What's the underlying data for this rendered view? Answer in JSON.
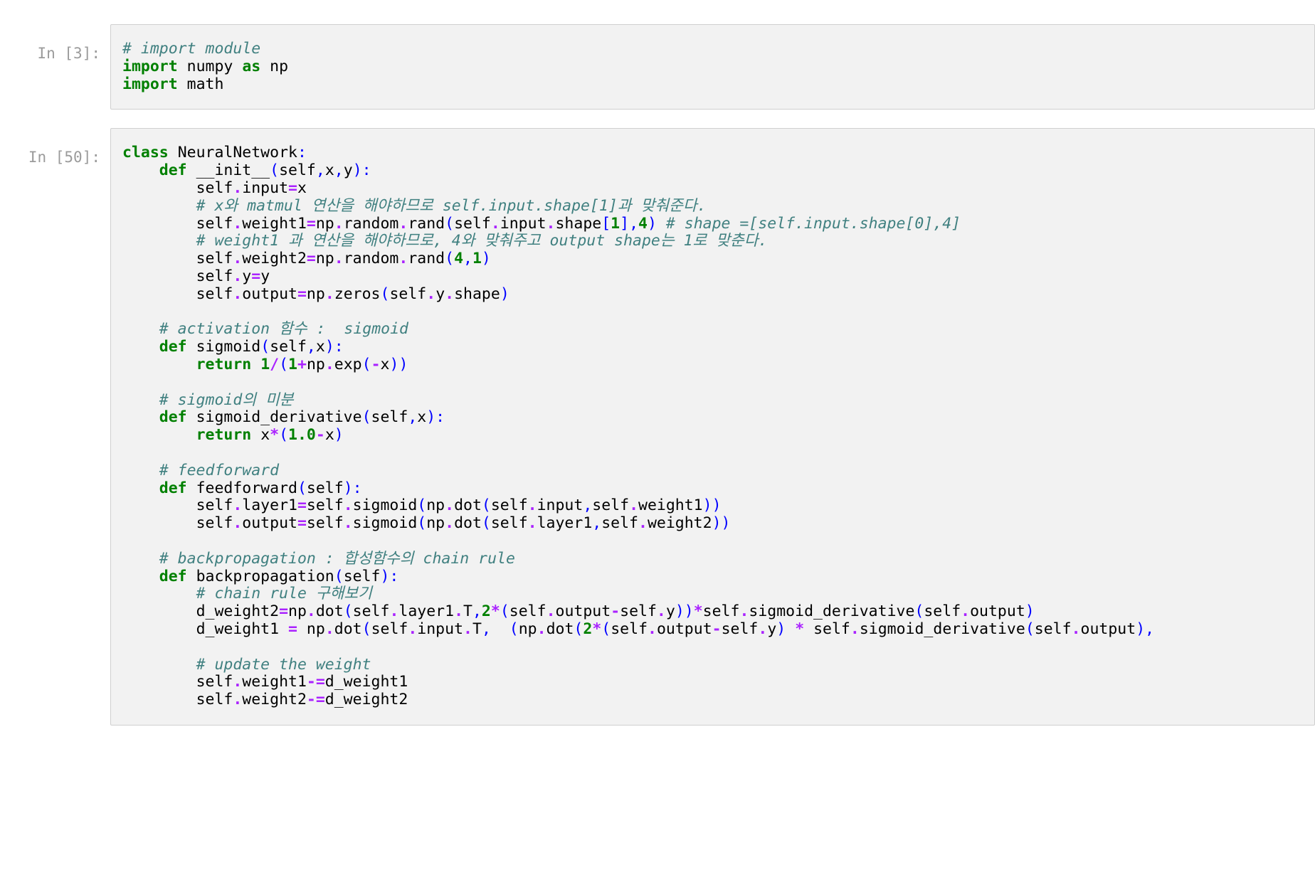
{
  "notebook": {
    "cells": [
      {
        "prompt": "In [3]:",
        "lines": [
          "# import module",
          "import numpy as np",
          "import math"
        ],
        "source": "# import module\nimport numpy as np\nimport math"
      },
      {
        "prompt": "In [50]:",
        "lines": [
          "class NeuralNetwork:",
          "    def __init__(self,x,y):",
          "        self.input=x",
          "        # x와 matmul 연산을 해야하므로 self.input.shape[1]과 맞춰준다.",
          "        self.weight1=np.random.rand(self.input.shape[1],4) # shape =[self.input.shape[0],4]",
          "        # weight1 과 연산을 해야하므로, 4와 맞춰주고 output shape는 1로 맞춘다.",
          "        self.weight2=np.random.rand(4,1)",
          "        self.y=y",
          "        self.output=np.zeros(self.y.shape)",
          "",
          "    # activation 함수 :  sigmoid",
          "    def sigmoid(self,x):",
          "        return 1/(1+np.exp(-x))",
          "",
          "    # sigmoid의 미분",
          "    def sigmoid_derivative(self,x):",
          "        return x*(1.0-x)",
          "",
          "    # feedforward",
          "    def feedforward(self):",
          "        self.layer1=self.sigmoid(np.dot(self.input,self.weight1))",
          "        self.output=self.sigmoid(np.dot(self.layer1,self.weight2))",
          "",
          "    # backpropagation : 합성함수의 chain rule",
          "    def backpropagation(self):",
          "        # chain rule 구해보기",
          "        d_weight2=np.dot(self.layer1.T,2*(self.output-self.y))*self.sigmoid_derivative(self.output)",
          "        d_weight1 = np.dot(self.input.T,  (np.dot(2*(self.output-self.y) * self.sigmoid_derivative(self.output),",
          "",
          "        # update the weight",
          "        self.weight1-=d_weight1",
          "        self.weight2-=d_weight2"
        ],
        "source": "class NeuralNetwork:\n    def __init__(self,x,y):\n        self.input=x\n        # x와 matmul 연산을 해야하므로 self.input.shape[1]과 맞춰준다.\n        self.weight1=np.random.rand(self.input.shape[1],4) # shape =[self.input.shape[0],4]\n        # weight1 과 연산을 해야하므로, 4와 맞춰주고 output shape는 1로 맞춘다.\n        self.weight2=np.random.rand(4,1)\n        self.y=y\n        self.output=np.zeros(self.y.shape)\n\n    # activation 함수 :  sigmoid\n    def sigmoid(self,x):\n        return 1/(1+np.exp(-x))\n\n    # sigmoid의 미분\n    def sigmoid_derivative(self,x):\n        return x*(1.0-x)\n\n    # feedforward\n    def feedforward(self):\n        self.layer1=self.sigmoid(np.dot(self.input,self.weight1))\n        self.output=self.sigmoid(np.dot(self.layer1,self.weight2))\n\n    # backpropagation : 합성함수의 chain rule\n    def backpropagation(self):\n        # chain rule 구해보기\n        d_weight2=np.dot(self.layer1.T,2*(self.output-self.y))*self.sigmoid_derivative(self.output)\n        d_weight1 = np.dot(self.input.T,  (np.dot(2*(self.output-self.y) * self.sigmoid_derivative(self.output),\n\n        # update the weight\n        self.weight1-=d_weight1\n        self.weight2-=d_weight2"
      }
    ]
  },
  "colors": {
    "comment": "#408080",
    "keyword": "#008000",
    "function": "#0000FF",
    "operator": "#AA22FF",
    "number": "#008000",
    "text": "#000000",
    "prompt": "#9b9b9b",
    "cell_background": "#f2f2f2",
    "cell_border": "#cfcfcf",
    "page_background": "#ffffff"
  }
}
